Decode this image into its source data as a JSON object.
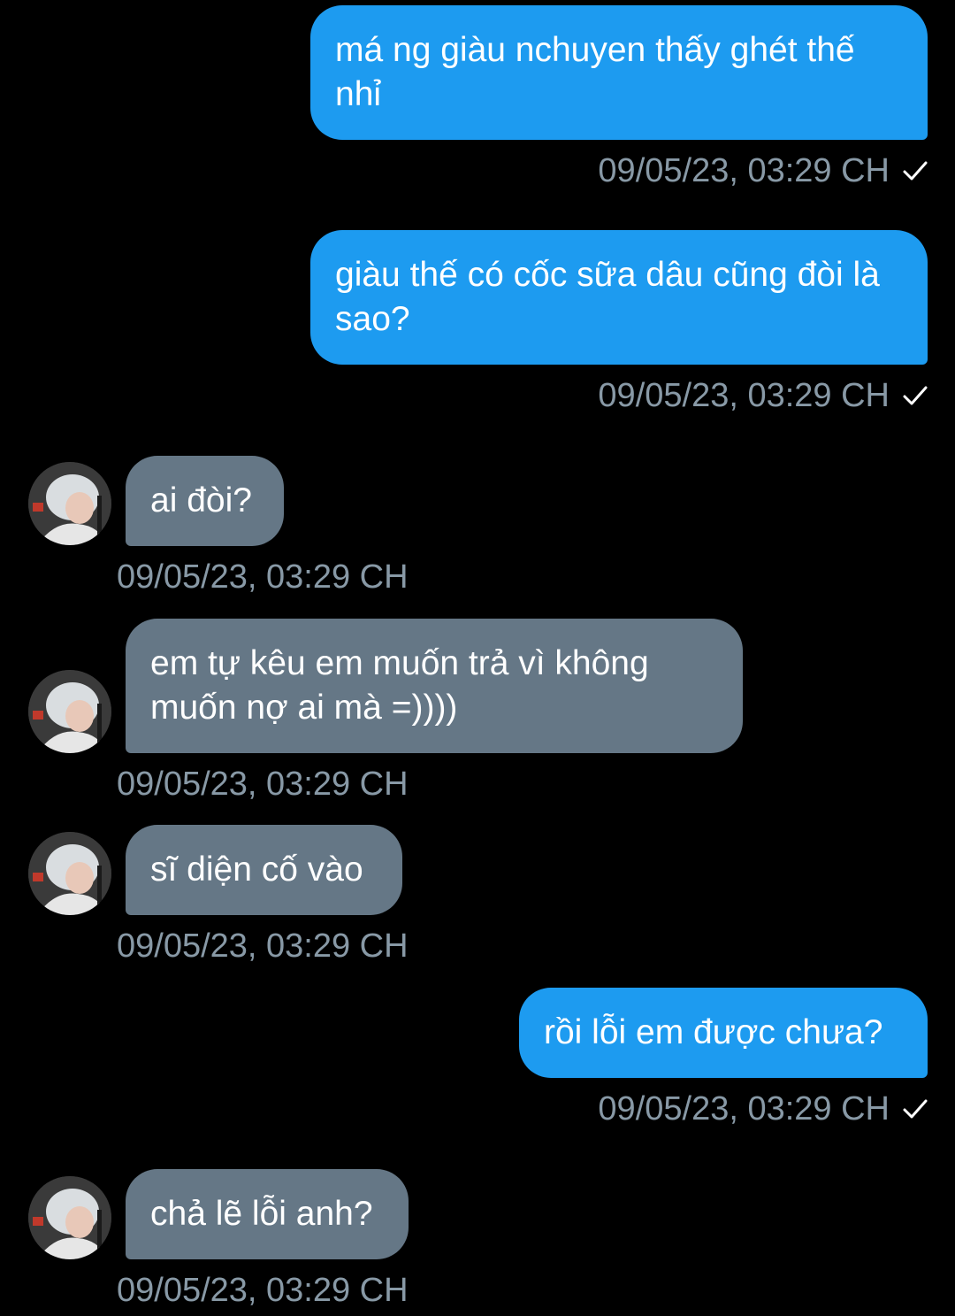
{
  "messages": [
    {
      "direction": "sent",
      "text": "má ng giàu nchuyen thấy ghét thế nhỉ",
      "time": "09/05/23, 03:29 CH"
    },
    {
      "direction": "sent",
      "text": "giàu thế có cốc sữa dâu cũng đòi là sao?",
      "time": "09/05/23, 03:29 CH"
    },
    {
      "direction": "received",
      "text": "ai đòi?",
      "time": "09/05/23, 03:29 CH"
    },
    {
      "direction": "received",
      "text": "em tự kêu em muốn trả vì không muốn nợ ai mà =))))",
      "time": "09/05/23, 03:29 CH"
    },
    {
      "direction": "received",
      "text": "sĩ diện cố vào",
      "time": "09/05/23, 03:29 CH"
    },
    {
      "direction": "sent",
      "text": "rồi lỗi em được chưa?",
      "time": "09/05/23, 03:29 CH"
    },
    {
      "direction": "received",
      "text": "chả lẽ lỗi anh?",
      "time": "09/05/23, 03:29 CH"
    }
  ],
  "colors": {
    "sent_bubble": "#1d9bf0",
    "received_bubble": "#657786",
    "timestamp": "#8899a6",
    "background": "#000000"
  },
  "icons": {
    "sent_status": "check-icon",
    "avatar": "user-avatar"
  }
}
